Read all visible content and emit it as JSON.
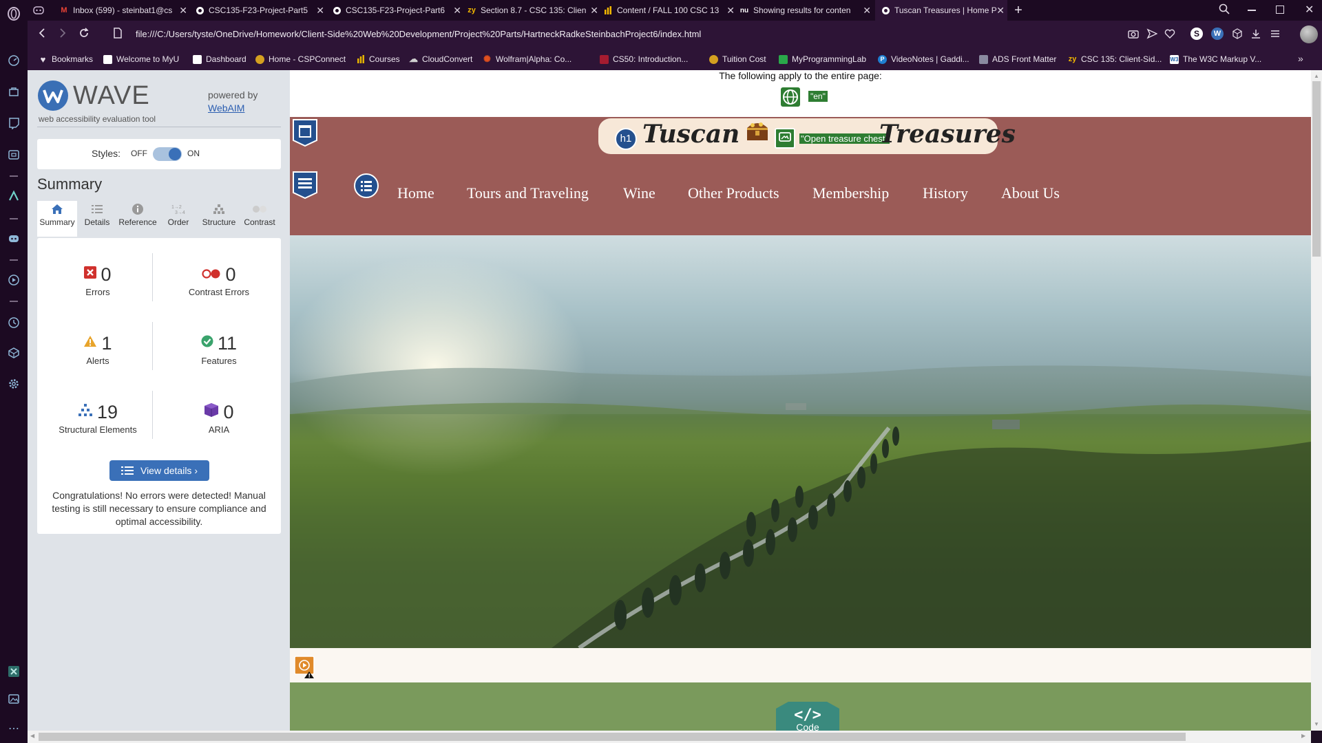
{
  "browser": {
    "tabs": [
      {
        "title": "Inbox (599) - steinbat1@cs",
        "icon": "gmail-icon",
        "active": false
      },
      {
        "title": "CSC135-F23-Project-Part5",
        "icon": "globe-icon",
        "active": false
      },
      {
        "title": "CSC135-F23-Project-Part6",
        "icon": "globe-icon",
        "active": false
      },
      {
        "title": "Section 8.7 - CSC 135: Clien",
        "icon": "zybooks-icon",
        "active": false
      },
      {
        "title": "Content / FALL 100 CSC 13",
        "icon": "chart-icon",
        "active": false
      },
      {
        "title": "Showing results for conten",
        "icon": "nu-icon",
        "active": false
      },
      {
        "title": "Tuscan Treasures | Home P",
        "icon": "globe-icon",
        "active": true
      }
    ],
    "new_tab": "+",
    "url": "file:///C:/Users/tyste/OneDrive/Homework/Client-Side%20Web%20Development/Project%20Parts/HartneckRadkeSteinbachProject6/index.html",
    "bookmarks": [
      {
        "label": "Bookmarks",
        "color": "#e8e0ea"
      },
      {
        "label": "Welcome to MyU",
        "color": "#ffffff"
      },
      {
        "label": "Dashboard",
        "color": "#ffffff"
      },
      {
        "label": "Home - CSPConnect",
        "color": "#d4a020"
      },
      {
        "label": "Courses",
        "color": "#e6b400"
      },
      {
        "label": "CloudConvert",
        "color": "#cfcfcf"
      },
      {
        "label": "Wolfram|Alpha: Co...",
        "color": "#e0501e"
      },
      {
        "label": "CS50: Introduction...",
        "color": "#a51c30"
      },
      {
        "label": "Tuition Cost",
        "color": "#d4a020"
      },
      {
        "label": "MyProgrammingLab",
        "color": "#2aa84a"
      },
      {
        "label": "VideoNotes | Gaddi...",
        "color": "#1f7fd1"
      },
      {
        "label": "ADS Front Matter",
        "color": "#8a8aa0"
      },
      {
        "label": "CSC 135: Client-Sid...",
        "color": "#f2b800"
      },
      {
        "label": "The W3C Markup V...",
        "color": "#1f5fa8"
      }
    ]
  },
  "wave": {
    "title": "WAVE",
    "subtitle": "web accessibility evaluation tool",
    "powered_by": "powered by",
    "webaim": "WebAIM",
    "styles_label": "Styles:",
    "off": "OFF",
    "on": "ON",
    "summary_heading": "Summary",
    "tabs": [
      "Summary",
      "Details",
      "Reference",
      "Order",
      "Structure",
      "Contrast"
    ],
    "stats": {
      "errors": {
        "value": "0",
        "label": "Errors"
      },
      "contrast": {
        "value": "0",
        "label": "Contrast Errors"
      },
      "alerts": {
        "value": "1",
        "label": "Alerts"
      },
      "features": {
        "value": "11",
        "label": "Features"
      },
      "structural": {
        "value": "19",
        "label": "Structural Elements"
      },
      "aria": {
        "value": "0",
        "label": "ARIA"
      }
    },
    "view_details": "View details ›",
    "message": "Congratulations! No errors were detected! Manual testing is still necessary to ensure compliance and optimal accessibility.",
    "accent": "#3a70b8"
  },
  "page": {
    "entire_page_note": "The following apply to the entire page:",
    "lang_badge": "\"en\"",
    "h1_badge": "h1",
    "title_left": "Tuscan",
    "alt_badge": "\"Open treasure chest\"",
    "title_right": "Treasures",
    "nav": [
      "Home",
      "Tours and Traveling",
      "Wine",
      "Other Products",
      "Membership",
      "History",
      "About Us"
    ],
    "code_label": "Code",
    "header_color": "#9b5b57",
    "footer_color": "#7a9a5c"
  }
}
